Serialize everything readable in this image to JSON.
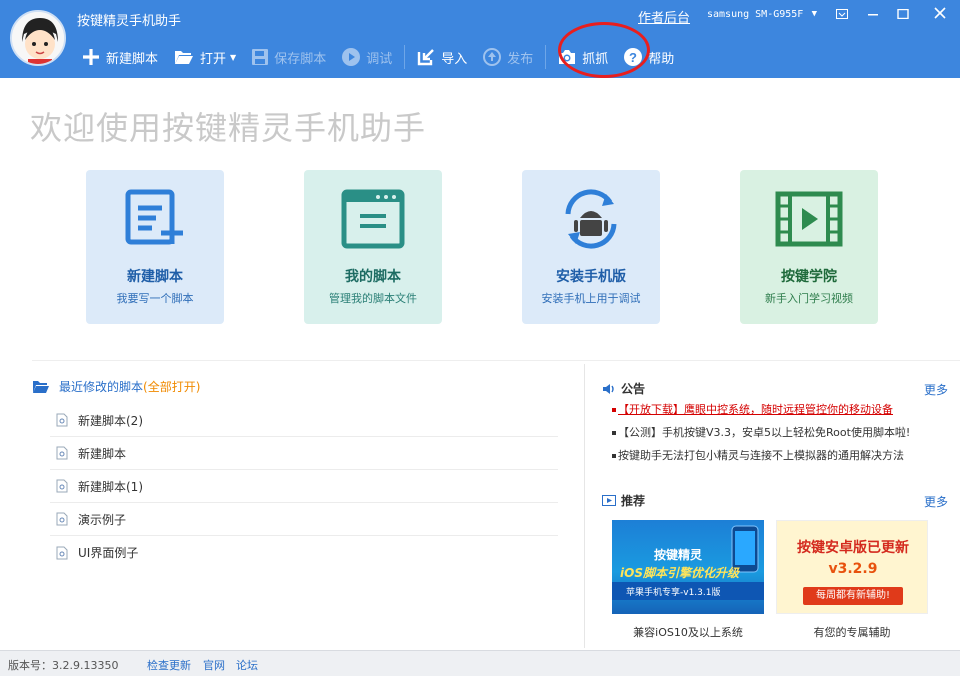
{
  "window": {
    "title": "按键精灵手机助手",
    "author_link": "作者后台",
    "device": "samsung SM-G955F",
    "controls": {
      "menu": "▣",
      "minimize": "—",
      "maximize": "☐",
      "close": "✕"
    }
  },
  "toolbar": {
    "new_script": "新建脚本",
    "open": "打开",
    "save_script": "保存脚本",
    "debug": "调试",
    "import": "导入",
    "publish": "发布",
    "capture": "抓抓",
    "help": "帮助"
  },
  "welcome": "欢迎使用按键精灵手机助手",
  "cards": [
    {
      "title": "新建脚本",
      "subtitle": "我要写一个脚本",
      "icon": "new-script-icon"
    },
    {
      "title": "我的脚本",
      "subtitle": "管理我的脚本文件",
      "icon": "my-scripts-icon"
    },
    {
      "title": "安装手机版",
      "subtitle": "安装手机上用于调试",
      "icon": "android-install-icon"
    },
    {
      "title": "按键学院",
      "subtitle": "新手入门学习视频",
      "icon": "video-icon"
    }
  ],
  "recent": {
    "title": "最近修改的脚本",
    "open_all": "(全部打开)",
    "items": [
      "新建脚本(2)",
      "新建脚本",
      "新建脚本(1)",
      "演示例子",
      "UI界面例子"
    ]
  },
  "notice": {
    "title": "公告",
    "more": "更多",
    "items": [
      {
        "text": "【开放下载】鹰眼中控系统，随时远程管控你的移动设备",
        "hot": true
      },
      {
        "text": "【公测】手机按键V3.3，安卓5以上轻松免Root使用脚本啦!",
        "hot": false
      },
      {
        "text": "按键助手无法打包小精灵与连接不上模拟器的通用解决方法",
        "hot": false
      }
    ]
  },
  "recommend": {
    "title": "推荐",
    "more": "更多",
    "items": [
      {
        "banner_title": "按键精灵",
        "banner_line1": "iOS脚本引擎优化升级",
        "banner_line2": "苹果手机专享-v1.3.1版",
        "caption": "兼容iOS10及以上系统"
      },
      {
        "banner_title": "按键安卓版已更新",
        "banner_line1": "v3.2.9",
        "banner_line2": "每周都有新辅助!",
        "caption": "有您的专属辅助"
      }
    ]
  },
  "status": {
    "version": "版本号：3.2.9.13350",
    "check_update": "检查更新",
    "official": "官网",
    "forum": "论坛"
  },
  "colors": {
    "accent": "#3d86de",
    "highlight": "#e81e1e",
    "link": "#2a6fc9",
    "orange": "#f08a00"
  }
}
